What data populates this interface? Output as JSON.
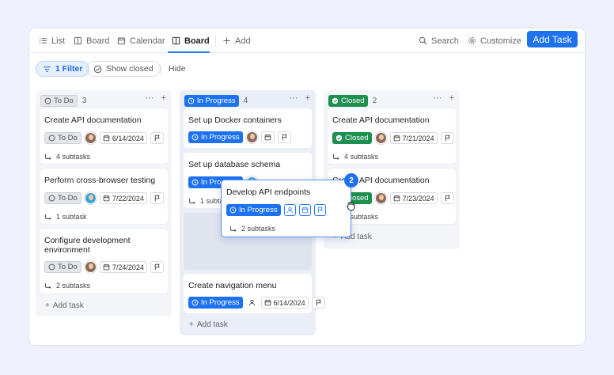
{
  "tabs": [
    {
      "label": "List",
      "icon": "list-icon"
    },
    {
      "label": "Board",
      "icon": "board-icon"
    },
    {
      "label": "Calendar",
      "icon": "calendar-icon"
    },
    {
      "label": "Board",
      "icon": "board-icon",
      "active": true
    },
    {
      "label": "Add",
      "icon": "plus-icon"
    }
  ],
  "toolbar": {
    "search": "Search",
    "customize": "Customize",
    "add_task": "Add Task"
  },
  "filters": {
    "filter": "1 Filter",
    "show_closed": "Show closed",
    "hide": "Hide"
  },
  "columns": [
    {
      "status": "To Do",
      "count": "3",
      "cards": [
        {
          "title": "Create API documentation",
          "status": "To Do",
          "date": "6/14/2024",
          "subtasks": "4 subtasks"
        },
        {
          "title": "Perform cross-browser testing",
          "status": "To Do",
          "date": "7/22/2024",
          "subtasks": "1 subtask"
        },
        {
          "title": "Configure development environment",
          "status": "To Do",
          "date": "7/24/2024",
          "subtasks": "2 subtasks"
        }
      ],
      "add_task": "Add task"
    },
    {
      "status": "In Progress",
      "count": "4",
      "cards": [
        {
          "title": "Set up Docker containers",
          "status": "In Progress"
        },
        {
          "title": "Set up database schema",
          "status": "In Progress",
          "subtasks": "1 subtask"
        },
        {
          "title": "Create navigation menu",
          "status": "In Progress",
          "date": "6/14/2024"
        }
      ],
      "add_task": "Add task"
    },
    {
      "status": "Closed",
      "count": "2",
      "cards": [
        {
          "title": "Create API documentation",
          "status": "Closed",
          "date": "7/21/2024",
          "subtasks": "4 subtasks"
        },
        {
          "title": "Create API documentation",
          "status": "Closed",
          "date": "7/23/2024",
          "subtasks": "4 subtasks"
        }
      ],
      "add_task": "Add task"
    }
  ],
  "dragging": {
    "title": "Develop API endpoints",
    "status": "In Progress",
    "subtasks": "2 subtasks",
    "badge": "2"
  },
  "colors": {
    "accent": "#1d72f2",
    "closed": "#1e8f4e",
    "todo_bg": "#e4e6ea"
  }
}
